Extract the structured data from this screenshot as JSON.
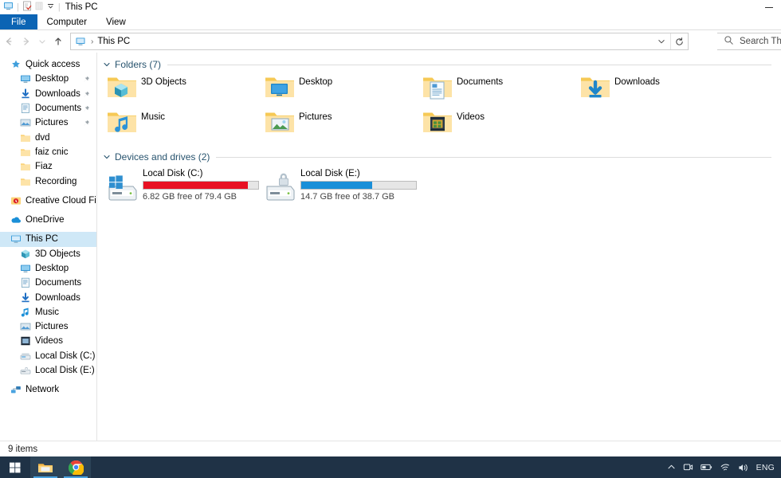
{
  "window": {
    "title": "This PC",
    "quick_access_icons": [
      "monitor-icon",
      "properties-icon",
      "new-folder-icon",
      "customize-chevron-icon"
    ],
    "minimize_label": "Minimize"
  },
  "ribbon": {
    "tabs": [
      {
        "label": "File",
        "active_file": true
      },
      {
        "label": "Computer",
        "active_file": false
      },
      {
        "label": "View",
        "active_file": false
      }
    ],
    "file_tab_color": "#0c64b4"
  },
  "nav": {
    "back_label": "Back",
    "forward_label": "Forward",
    "recent_label": "Recent locations",
    "up_label": "Up",
    "breadcrumb": "This PC",
    "address_chevron": "chevron-down-icon",
    "refresh_label": "Refresh"
  },
  "search": {
    "placeholder": "Search This"
  },
  "sidebar": {
    "items": [
      {
        "label": "Quick access",
        "icon": "star-icon",
        "indent": 0,
        "pinned": false,
        "selected": false
      },
      {
        "label": "Desktop",
        "icon": "desktop-icon",
        "indent": 1,
        "pinned": true,
        "selected": false
      },
      {
        "label": "Downloads",
        "icon": "download-icon",
        "indent": 1,
        "pinned": true,
        "selected": false
      },
      {
        "label": "Documents",
        "icon": "documents-icon",
        "indent": 1,
        "pinned": true,
        "selected": false
      },
      {
        "label": "Pictures",
        "icon": "pictures-icon",
        "indent": 1,
        "pinned": true,
        "selected": false
      },
      {
        "label": "dvd",
        "icon": "folder-icon",
        "indent": 1,
        "pinned": false,
        "selected": false
      },
      {
        "label": "faiz cnic",
        "icon": "folder-icon",
        "indent": 1,
        "pinned": false,
        "selected": false
      },
      {
        "label": "Fiaz",
        "icon": "folder-icon",
        "indent": 1,
        "pinned": false,
        "selected": false
      },
      {
        "label": "Recording",
        "icon": "folder-icon",
        "indent": 1,
        "pinned": false,
        "selected": false
      },
      {
        "label": "Creative Cloud Files",
        "icon": "creative-cloud-icon",
        "indent": 0,
        "pinned": false,
        "selected": false
      },
      {
        "label": "OneDrive",
        "icon": "onedrive-icon",
        "indent": 0,
        "pinned": false,
        "selected": false
      },
      {
        "label": "This PC",
        "icon": "monitor-icon",
        "indent": 0,
        "pinned": false,
        "selected": true
      },
      {
        "label": "3D Objects",
        "icon": "3d-objects-icon",
        "indent": 1,
        "pinned": false,
        "selected": false
      },
      {
        "label": "Desktop",
        "icon": "desktop-icon",
        "indent": 1,
        "pinned": false,
        "selected": false
      },
      {
        "label": "Documents",
        "icon": "documents-icon",
        "indent": 1,
        "pinned": false,
        "selected": false
      },
      {
        "label": "Downloads",
        "icon": "download-icon",
        "indent": 1,
        "pinned": false,
        "selected": false
      },
      {
        "label": "Music",
        "icon": "music-icon",
        "indent": 1,
        "pinned": false,
        "selected": false
      },
      {
        "label": "Pictures",
        "icon": "pictures-icon",
        "indent": 1,
        "pinned": false,
        "selected": false
      },
      {
        "label": "Videos",
        "icon": "videos-icon",
        "indent": 1,
        "pinned": false,
        "selected": false
      },
      {
        "label": "Local Disk (C:)",
        "icon": "drive-icon",
        "indent": 1,
        "pinned": false,
        "selected": false
      },
      {
        "label": "Local Disk (E:)",
        "icon": "drive-locked-icon",
        "indent": 1,
        "pinned": false,
        "selected": false
      },
      {
        "label": "Network",
        "icon": "network-icon",
        "indent": 0,
        "pinned": false,
        "selected": false
      }
    ]
  },
  "content": {
    "folders_section": {
      "title": "Folders (7)",
      "collapse_icon": "chevron-down-icon",
      "items": [
        {
          "label": "3D Objects",
          "icon": "folder-3d-objects-icon"
        },
        {
          "label": "Desktop",
          "icon": "folder-desktop-icon"
        },
        {
          "label": "Documents",
          "icon": "folder-documents-icon"
        },
        {
          "label": "Downloads",
          "icon": "folder-downloads-icon"
        },
        {
          "label": "Music",
          "icon": "folder-music-icon"
        },
        {
          "label": "Pictures",
          "icon": "folder-pictures-icon"
        },
        {
          "label": "Videos",
          "icon": "folder-videos-icon"
        }
      ]
    },
    "drives_section": {
      "title": "Devices and drives (2)",
      "collapse_icon": "chevron-down-icon",
      "items": [
        {
          "label": "Local Disk (C:)",
          "icon": "drive-windows-icon",
          "free_text": "6.82 GB free of 79.4 GB",
          "used_percent": 91,
          "bar_color": "#e81123"
        },
        {
          "label": "Local Disk (E:)",
          "icon": "drive-locked-icon",
          "free_text": "14.7 GB free of 38.7 GB",
          "used_percent": 62,
          "bar_color": "#1a8fd8"
        }
      ]
    }
  },
  "statusbar": {
    "item_count": "9 items"
  },
  "taskbar": {
    "background": "#1f3246",
    "start_label": "Start",
    "apps": [
      {
        "name": "file-explorer-taskbar-icon",
        "active": true
      },
      {
        "name": "google-chrome-taskbar-icon",
        "active": true
      }
    ],
    "tray": {
      "show_hidden_label": "Show hidden icons",
      "icons": [
        "meet-now-icon",
        "battery-icon",
        "wifi-icon",
        "volume-icon"
      ],
      "language": "ENG"
    }
  }
}
